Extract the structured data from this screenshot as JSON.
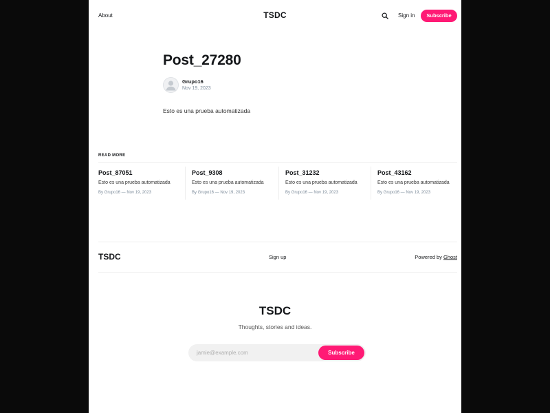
{
  "header": {
    "nav_about": "About",
    "site_title": "TSDC",
    "search_icon": "search-icon",
    "signin_label": "Sign in",
    "subscribe_label": "Subscribe",
    "accent_color": "#ff1a75"
  },
  "article": {
    "title": "Post_27280",
    "author": "Grupo16",
    "date": "Nov 19, 2023",
    "body": "Esto es una prueba automatizada",
    "avatar_icon": "avatar-placeholder-icon"
  },
  "read_more": {
    "heading": "READ MORE",
    "posts": [
      {
        "title": "Post_87051",
        "excerpt": "Esto es una prueba automatizada",
        "meta": "By Grupo16 — Nov 19, 2023"
      },
      {
        "title": "Post_9308",
        "excerpt": "Esto es una prueba automatizada",
        "meta": "By Grupo16 — Nov 19, 2023"
      },
      {
        "title": "Post_31232",
        "excerpt": "Esto es una prueba automatizada",
        "meta": "By Grupo16 — Nov 19, 2023"
      },
      {
        "title": "Post_43162",
        "excerpt": "Esto es una prueba automatizada",
        "meta": "By Grupo16 — Nov 19, 2023"
      }
    ]
  },
  "footer": {
    "site_title": "TSDC",
    "signup_label": "Sign up",
    "powered_prefix": "Powered by ",
    "powered_link": "Ghost"
  },
  "cta": {
    "title": "TSDC",
    "tagline": "Thoughts, stories and ideas.",
    "email_placeholder": "jamie@example.com",
    "subscribe_label": "Subscribe"
  }
}
